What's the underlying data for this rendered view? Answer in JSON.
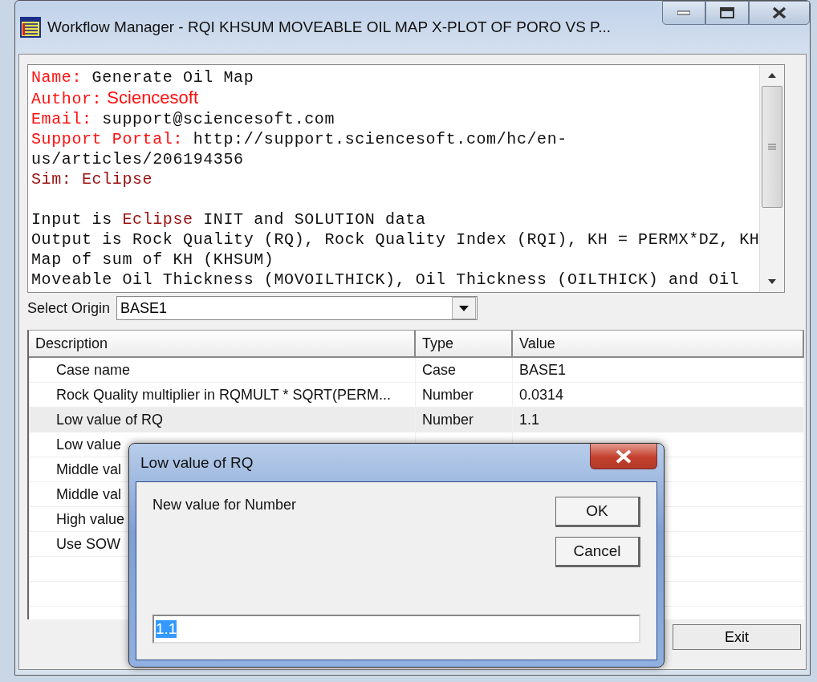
{
  "window": {
    "title": "Workflow Manager - RQI KHSUM MOVEABLE OIL MAP X-PLOT OF PORO VS P..."
  },
  "description": {
    "header_lines": [
      {
        "segments": [
          {
            "kind": "label",
            "text": "Name:"
          },
          {
            "kind": "plain",
            "text": " Generate Oil Map"
          }
        ]
      },
      {
        "segments": [
          {
            "kind": "label",
            "text": "Author:"
          },
          {
            "kind": "author",
            "text": " Sciencesoft"
          }
        ]
      },
      {
        "segments": [
          {
            "kind": "label",
            "text": "Email:"
          },
          {
            "kind": "plain",
            "text": " support@sciencesoft.com"
          }
        ]
      },
      {
        "segments": [
          {
            "kind": "label",
            "text": "Support Portal:"
          },
          {
            "kind": "plain",
            "text": " http://support.sciencesoft.com/hc/en-"
          }
        ]
      },
      {
        "segments": [
          {
            "kind": "plain",
            "text": "us/articles/206194356"
          }
        ]
      },
      {
        "segments": [
          {
            "kind": "accent",
            "text": "Sim: Eclipse"
          }
        ]
      }
    ],
    "body_lines": [
      {
        "segments": [
          {
            "kind": "plain",
            "text": "Input is "
          },
          {
            "kind": "accent",
            "text": "Eclipse"
          },
          {
            "kind": "plain",
            "text": " INIT and SOLUTION data"
          }
        ]
      },
      {
        "segments": [
          {
            "kind": "plain",
            "text": "Output is Rock Quality (RQ), Rock Quality Index (RQI), KH = PERMX*DZ, KH"
          }
        ]
      },
      {
        "segments": [
          {
            "kind": "plain",
            "text": "Map of sum of KH (KHSUM)"
          }
        ]
      },
      {
        "segments": [
          {
            "kind": "plain",
            "text": "Moveable Oil Thickness (MOVOILTHICK), Oil Thickness (OILTHICK) and Oil"
          }
        ]
      }
    ]
  },
  "origin": {
    "label": "Select Origin",
    "value": "BASE1"
  },
  "table": {
    "columns": [
      "Description",
      "Type",
      "Value"
    ],
    "rows": [
      {
        "cells": [
          "Case name",
          "Case",
          "BASE1"
        ],
        "selected": false
      },
      {
        "cells": [
          "Rock Quality multiplier in RQMULT * SQRT(PERM...",
          "Number",
          "0.0314"
        ],
        "selected": false
      },
      {
        "cells": [
          "Low value of RQ",
          "Number",
          "1.1"
        ],
        "selected": true
      },
      {
        "cells": [
          "Low value"
        ],
        "selected": false
      },
      {
        "cells": [
          "Middle val"
        ],
        "selected": false
      },
      {
        "cells": [
          "Middle val"
        ],
        "selected": false
      },
      {
        "cells": [
          "High value"
        ],
        "selected": false
      },
      {
        "cells": [
          "Use SOW"
        ],
        "selected": false
      }
    ]
  },
  "buttons": [
    "Exit"
  ],
  "dialog": {
    "title": "Low value of RQ",
    "prompt": "New value for Number",
    "buttons": [
      "OK",
      "Cancel"
    ],
    "input": {
      "value": "1.1",
      "text_selected": true
    }
  }
}
